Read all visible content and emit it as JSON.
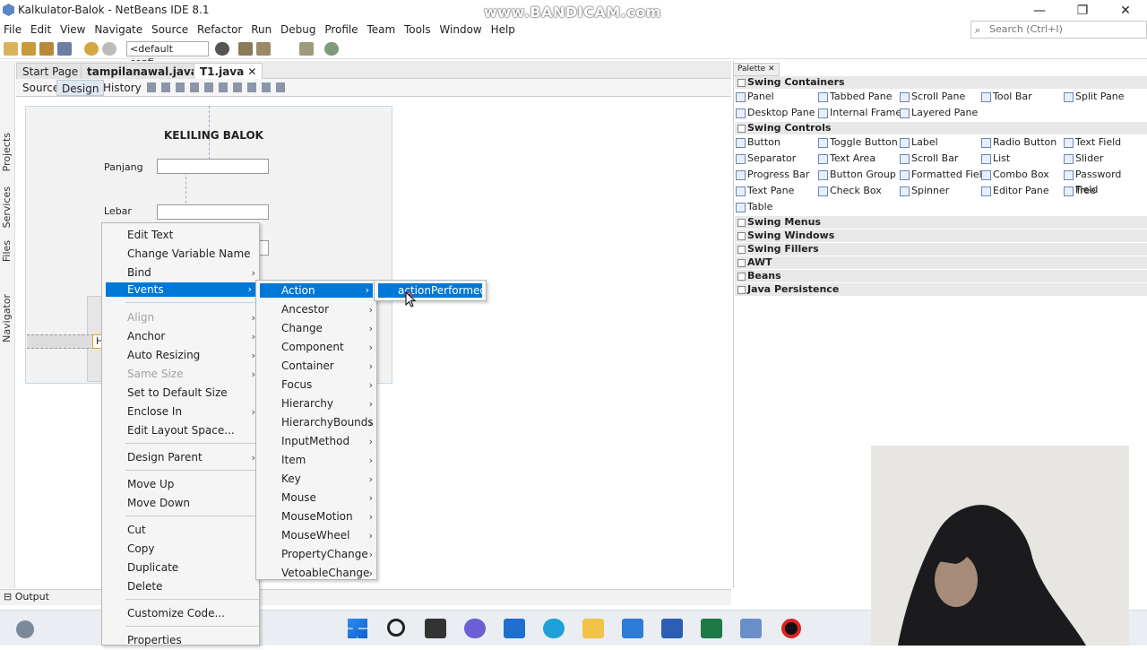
{
  "window": {
    "title": "Kalkulator-Balok - NetBeans IDE 8.1",
    "watermark": "www.BANDICAM.com",
    "minimize": "—",
    "maximize": "❐",
    "close": "✕"
  },
  "menubar": [
    "File",
    "Edit",
    "View",
    "Navigate",
    "Source",
    "Refactor",
    "Run",
    "Debug",
    "Profile",
    "Team",
    "Tools",
    "Window",
    "Help"
  ],
  "search": {
    "placeholder": "Search (Ctrl+I)"
  },
  "toolbar": {
    "config": "<default confi..."
  },
  "left_strip": [
    "Projects",
    "Services",
    "Files",
    "Navigator"
  ],
  "editor_tabs": [
    {
      "label": "Start Page"
    },
    {
      "label": "tampilanawal.java"
    },
    {
      "label": "T1.java"
    }
  ],
  "design_tabs": [
    "Source",
    "Design",
    "History"
  ],
  "form": {
    "title": "KELILING BALOK",
    "label_panjang": "Panjang",
    "label_lebar": "Lebar",
    "partial_button": "H"
  },
  "palette": {
    "header": "Palette",
    "categories": [
      {
        "name": "Swing Containers",
        "items": [
          "Panel",
          "Tabbed Pane",
          "Scroll Pane",
          "Tool Bar",
          "Split Pane",
          "Desktop Pane",
          "Internal Frame",
          "Layered Pane"
        ]
      },
      {
        "name": "Swing Controls",
        "items": [
          "Button",
          "Toggle Button",
          "Label",
          "Radio Button",
          "Text Field",
          "Separator",
          "Text Area",
          "Scroll Bar",
          "List",
          "Slider",
          "Progress Bar",
          "Button Group",
          "Formatted Field",
          "Combo Box",
          "Password Field",
          "Text Pane",
          "Check Box",
          "Spinner",
          "Editor Pane",
          "Tree",
          "Table"
        ]
      },
      {
        "name": "Swing Menus",
        "items": []
      },
      {
        "name": "Swing Windows",
        "items": []
      },
      {
        "name": "Swing Fillers",
        "items": []
      },
      {
        "name": "AWT",
        "items": []
      },
      {
        "name": "Beans",
        "items": []
      },
      {
        "name": "Java Persistence",
        "items": []
      }
    ]
  },
  "output": {
    "label": "Output"
  },
  "context_menu": {
    "items": [
      {
        "label": "Edit Text"
      },
      {
        "label": "Change Variable Name ..."
      },
      {
        "label": "Bind"
      },
      {
        "label": "Events"
      },
      {
        "label": "Align"
      },
      {
        "label": "Anchor"
      },
      {
        "label": "Auto Resizing"
      },
      {
        "label": "Same Size"
      },
      {
        "label": "Set to Default Size"
      },
      {
        "label": "Enclose In"
      },
      {
        "label": "Edit Layout Space..."
      },
      {
        "label": "Design Parent"
      },
      {
        "label": "Move Up"
      },
      {
        "label": "Move Down"
      },
      {
        "label": "Cut"
      },
      {
        "label": "Copy"
      },
      {
        "label": "Duplicate"
      },
      {
        "label": "Delete"
      },
      {
        "label": "Customize Code..."
      },
      {
        "label": "Properties"
      }
    ]
  },
  "events_menu": {
    "items": [
      "Action",
      "Ancestor",
      "Change",
      "Component",
      "Container",
      "Focus",
      "Hierarchy",
      "HierarchyBounds",
      "InputMethod",
      "Item",
      "Key",
      "Mouse",
      "MouseMotion",
      "MouseWheel",
      "PropertyChange",
      "VetoableChange"
    ]
  },
  "action_menu": {
    "items": [
      "actionPerformed"
    ]
  }
}
